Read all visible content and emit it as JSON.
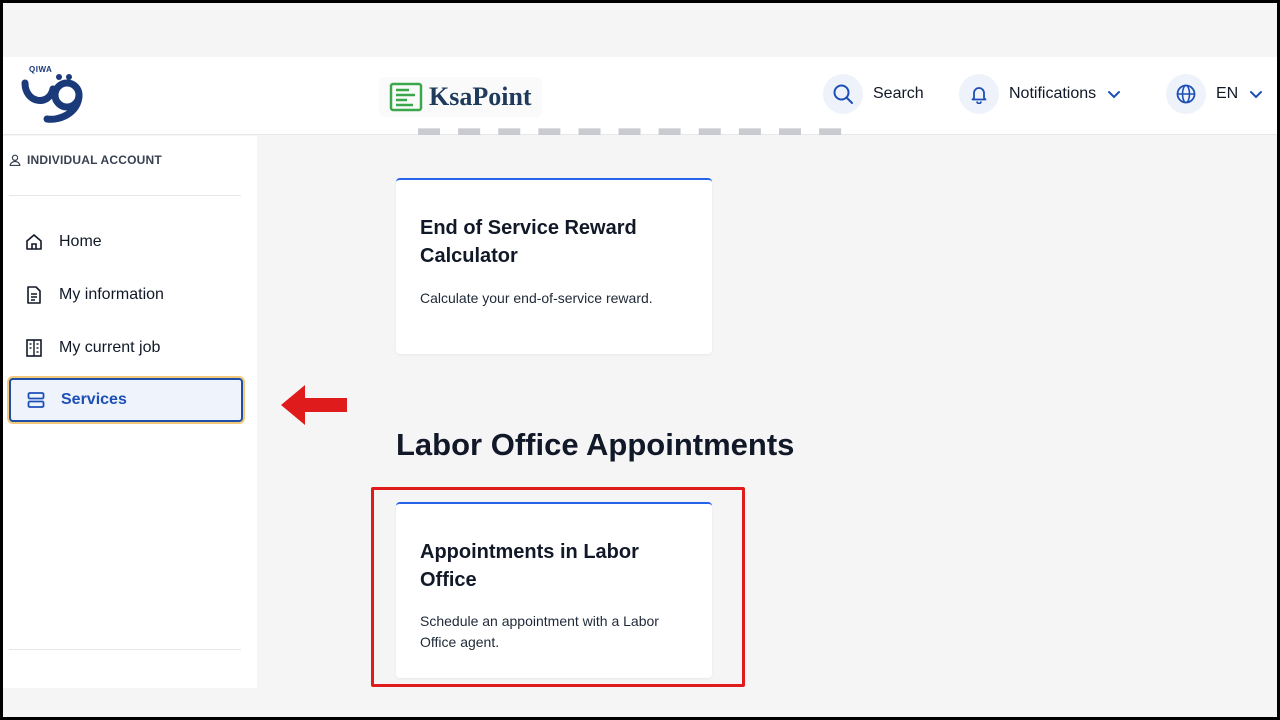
{
  "header": {
    "logo_text": "QIWA",
    "brand": "KsaPoint",
    "search_label": "Search",
    "notifications_label": "Notifications",
    "language_label": "EN"
  },
  "sidebar": {
    "account_label": "INDIVIDUAL ACCOUNT",
    "items": [
      {
        "label": "Home",
        "icon": "home-icon"
      },
      {
        "label": "My information",
        "icon": "document-icon"
      },
      {
        "label": "My current job",
        "icon": "building-icon"
      },
      {
        "label": "Services",
        "icon": "services-icon",
        "active": true
      }
    ]
  },
  "main": {
    "cards": [
      {
        "title_line1": "End of Service Reward",
        "title_line2": "Calculator",
        "description": "Calculate your end-of-service reward."
      },
      {
        "title_line1": "Appointments in Labor",
        "title_line2": "Office",
        "description_line1": "Schedule an appointment with a Labor",
        "description_line2": "Office agent."
      }
    ],
    "section_title": "Labor Office Appointments"
  },
  "colors": {
    "accent": "#2563eb",
    "active_text": "#1d4fb5",
    "annotation_red": "#e01b1b",
    "brand_green": "#3aa84a",
    "brand_navy": "#1f3b5c"
  }
}
